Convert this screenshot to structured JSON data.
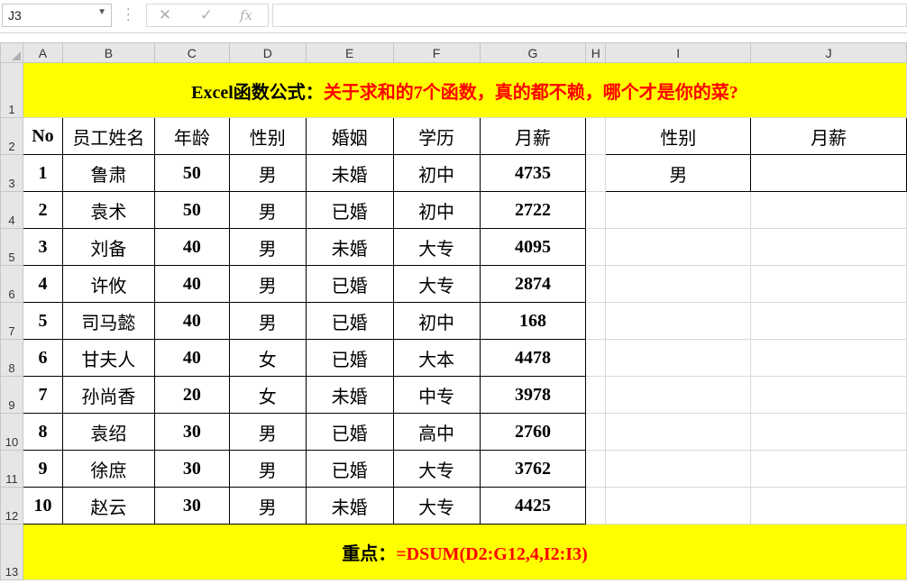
{
  "namebox": {
    "value": "J3"
  },
  "formula_bar": {
    "cancel_icon": "✕",
    "confirm_icon": "✓",
    "fx_label": "fx",
    "value": ""
  },
  "columns": [
    "A",
    "B",
    "C",
    "D",
    "E",
    "F",
    "G",
    "H",
    "I",
    "J"
  ],
  "rows": [
    "1",
    "2",
    "3",
    "4",
    "5",
    "6",
    "7",
    "8",
    "9",
    "10",
    "11",
    "12",
    "13"
  ],
  "title": {
    "black": "Excel函数公式：",
    "red": "关于求和的7个函数，真的都不赖，哪个才是你的菜?"
  },
  "headers": [
    "No",
    "员工姓名",
    "年龄",
    "性别",
    "婚姻",
    "学历",
    "月薪"
  ],
  "data": [
    [
      "1",
      "鲁肃",
      "50",
      "男",
      "未婚",
      "初中",
      "4735"
    ],
    [
      "2",
      "袁术",
      "50",
      "男",
      "已婚",
      "初中",
      "2722"
    ],
    [
      "3",
      "刘备",
      "40",
      "男",
      "未婚",
      "大专",
      "4095"
    ],
    [
      "4",
      "许攸",
      "40",
      "男",
      "已婚",
      "大专",
      "2874"
    ],
    [
      "5",
      "司马懿",
      "40",
      "男",
      "已婚",
      "初中",
      "168"
    ],
    [
      "6",
      "甘夫人",
      "40",
      "女",
      "已婚",
      "大本",
      "4478"
    ],
    [
      "7",
      "孙尚香",
      "20",
      "女",
      "未婚",
      "中专",
      "3978"
    ],
    [
      "8",
      "袁绍",
      "30",
      "男",
      "已婚",
      "高中",
      "2760"
    ],
    [
      "9",
      "徐庶",
      "30",
      "男",
      "已婚",
      "大专",
      "3762"
    ],
    [
      "10",
      "赵云",
      "30",
      "男",
      "未婚",
      "大专",
      "4425"
    ]
  ],
  "criteria": {
    "h1": "性别",
    "h2": "月薪",
    "v1": "男",
    "v2": ""
  },
  "footer": {
    "black": "重点：",
    "red": "=DSUM(D2:G12,4,I2:I3)"
  },
  "colors": {
    "highlight": "#ffff00",
    "accent": "#ff0000"
  }
}
